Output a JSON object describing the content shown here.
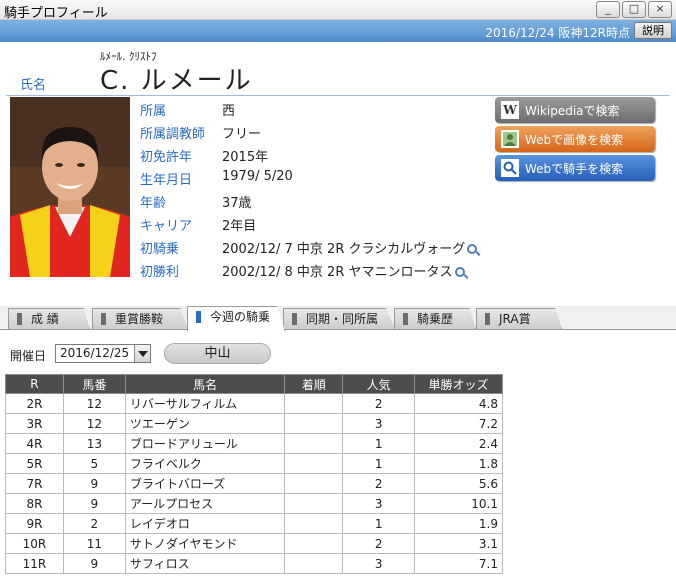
{
  "window": {
    "title": "騎手プロフィール",
    "buttons": [
      "_",
      "□",
      "×"
    ]
  },
  "header": {
    "timestamp": "2016/12/24 阪神12R時点",
    "help_label": "説明"
  },
  "profile": {
    "furigana": "ﾙﾒｰﾙ. ｸﾘｽﾄﾌ",
    "name_label": "氏名",
    "name": "C. ルメール",
    "fields": [
      {
        "key": "所属",
        "value": "西"
      },
      {
        "key": "所属調教師",
        "value": "フリー"
      },
      {
        "key": "初免許年",
        "value": "2015年"
      },
      {
        "key": "生年月日",
        "value": "1979/ 5/20"
      },
      {
        "key": "年齢",
        "value": "37歳"
      },
      {
        "key": "キャリア",
        "value": "2年目"
      },
      {
        "key": "初騎乗",
        "value": "2002/12/ 7 中京 2R クラシカルヴォーグ"
      },
      {
        "key": "初勝利",
        "value": "2002/12/ 8 中京 2R ヤマニンロータス"
      }
    ]
  },
  "search_buttons": {
    "wiki": {
      "label": "Wikipediaで検索",
      "icon": "W"
    },
    "image": {
      "label": "Webで画像を検索"
    },
    "jockey": {
      "label": "Webで騎手を検索"
    }
  },
  "tabs": [
    "成 績",
    "重賞勝鞍",
    "今週の騎乗",
    "同期・同所属",
    "騎乗歴",
    "JRA賞"
  ],
  "active_tab": "今週の騎乗",
  "filter": {
    "date_label": "開催日",
    "date_value": "2016/12/25",
    "venue": "中山"
  },
  "races_table": {
    "headers": [
      "R",
      "馬番",
      "馬名",
      "着順",
      "人気",
      "単勝オッズ"
    ],
    "rows": [
      [
        "2R",
        "12",
        "リバーサルフィルム",
        "",
        "2",
        "4.8"
      ],
      [
        "3R",
        "12",
        "ツエーゲン",
        "",
        "3",
        "7.2"
      ],
      [
        "4R",
        "13",
        "ブロードアリュール",
        "",
        "1",
        "2.4"
      ],
      [
        "5R",
        "5",
        "フライベルク",
        "",
        "1",
        "1.8"
      ],
      [
        "7R",
        "9",
        "ブライトバローズ",
        "",
        "2",
        "5.6"
      ],
      [
        "8R",
        "9",
        "アールプロセス",
        "",
        "3",
        "10.1"
      ],
      [
        "9R",
        "2",
        "レイデオロ",
        "",
        "1",
        "1.9"
      ],
      [
        "10R",
        "11",
        "サトノダイヤモンド",
        "",
        "2",
        "3.1"
      ],
      [
        "11R",
        "9",
        "サフィロス",
        "",
        "3",
        "7.1"
      ]
    ]
  }
}
